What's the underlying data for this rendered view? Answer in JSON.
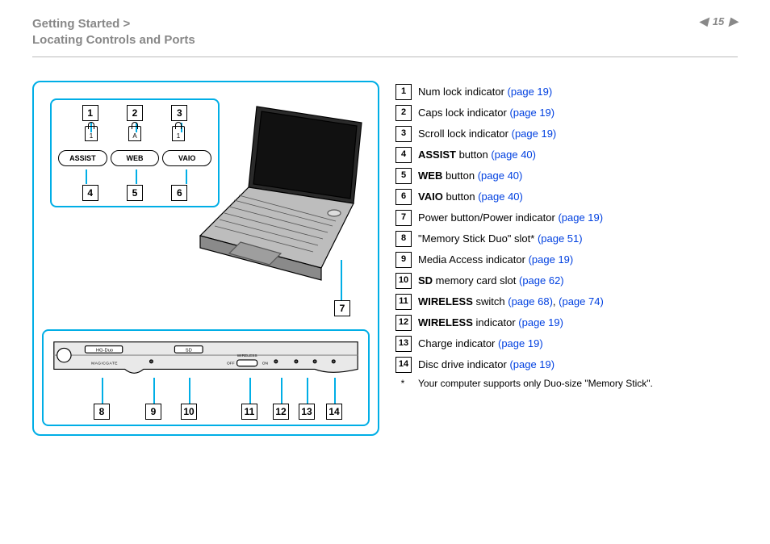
{
  "header": {
    "breadcrumb_line1": "Getting Started >",
    "breadcrumb_line2": "Locating Controls and Ports",
    "page_number": "15"
  },
  "top_callouts": {
    "nums_top": [
      "1",
      "2",
      "3"
    ],
    "lock_letters": [
      "1",
      "A",
      "1"
    ],
    "pills": [
      "ASSIST",
      "WEB",
      "VAIO"
    ],
    "nums_bottom": [
      "4",
      "5",
      "6"
    ]
  },
  "callout7": "7",
  "bottom_panel": {
    "text_hgduo": "HG-Duo",
    "text_magicgate": "MAGICGATE",
    "text_sd": "SD",
    "text_wireless": "WIRELESS",
    "text_off": "OFF",
    "text_on": "ON",
    "labels": [
      "8",
      "9",
      "10",
      "11",
      "12",
      "13",
      "14"
    ]
  },
  "legend": [
    {
      "n": "1",
      "pre": "",
      "bold": "",
      "mid": "Num lock indicator ",
      "links": [
        "(page 19)"
      ]
    },
    {
      "n": "2",
      "pre": "",
      "bold": "",
      "mid": "Caps lock indicator ",
      "links": [
        "(page 19)"
      ]
    },
    {
      "n": "3",
      "pre": "",
      "bold": "",
      "mid": "Scroll lock indicator ",
      "links": [
        "(page 19)"
      ]
    },
    {
      "n": "4",
      "pre": "",
      "bold": "ASSIST",
      "mid": " button ",
      "links": [
        "(page 40)"
      ]
    },
    {
      "n": "5",
      "pre": "",
      "bold": "WEB",
      "mid": " button ",
      "links": [
        "(page 40)"
      ]
    },
    {
      "n": "6",
      "pre": "",
      "bold": "VAIO",
      "mid": " button ",
      "links": [
        "(page 40)"
      ]
    },
    {
      "n": "7",
      "pre": "",
      "bold": "",
      "mid": "Power button/Power indicator ",
      "links": [
        "(page 19)"
      ]
    },
    {
      "n": "8",
      "pre": "",
      "bold": "",
      "mid": "\"Memory Stick Duo\" slot* ",
      "links": [
        "(page 51)"
      ]
    },
    {
      "n": "9",
      "pre": "",
      "bold": "",
      "mid": "Media Access indicator ",
      "links": [
        "(page 19)"
      ]
    },
    {
      "n": "10",
      "pre": "",
      "bold": "SD",
      "mid": " memory card slot ",
      "links": [
        "(page 62)"
      ]
    },
    {
      "n": "11",
      "pre": "",
      "bold": "WIRELESS",
      "mid": " switch ",
      "links": [
        "(page 68)",
        "(page 74)"
      ],
      "sep": ", "
    },
    {
      "n": "12",
      "pre": "",
      "bold": "WIRELESS",
      "mid": " indicator ",
      "links": [
        "(page 19)"
      ]
    },
    {
      "n": "13",
      "pre": "",
      "bold": "",
      "mid": "Charge indicator ",
      "links": [
        "(page 19)"
      ]
    },
    {
      "n": "14",
      "pre": "",
      "bold": "",
      "mid": "Disc drive indicator ",
      "links": [
        "(page 19)"
      ]
    }
  ],
  "footnote": {
    "mark": "*",
    "text": "Your computer supports only Duo-size \"Memory Stick\"."
  }
}
